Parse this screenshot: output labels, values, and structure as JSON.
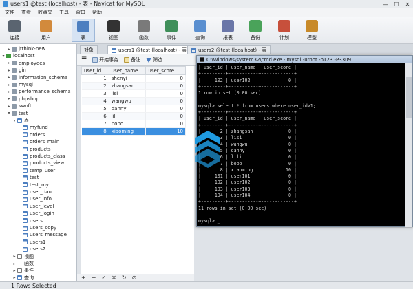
{
  "window": {
    "title": "users1 @test (localhost) - 表 - Navicat for MySQL",
    "controls": [
      "—",
      "☐",
      "✕"
    ]
  },
  "menu": [
    "文件",
    "查看",
    "收藏夹",
    "工具",
    "窗口",
    "帮助"
  ],
  "toolbar": [
    {
      "label": "连接",
      "icon": "plug-icon",
      "color": "#5a6470"
    },
    {
      "label": "用户",
      "icon": "user-icon",
      "color": "#d28a3c"
    },
    {
      "label": "表",
      "icon": "table-icon",
      "color": "#4d7fc0",
      "active": true
    },
    {
      "label": "视图",
      "icon": "glasses-icon",
      "color": "#333333"
    },
    {
      "label": "函数",
      "icon": "function-icon",
      "color": "#7a7a7a"
    },
    {
      "label": "事件",
      "icon": "event-icon",
      "color": "#3f8f5a"
    },
    {
      "label": "查询",
      "icon": "query-icon",
      "color": "#5a8fd0"
    },
    {
      "label": "报表",
      "icon": "report-icon",
      "color": "#6a76a8"
    },
    {
      "label": "备份",
      "icon": "backup-icon",
      "color": "#4aa35a"
    },
    {
      "label": "计划",
      "icon": "calendar-icon",
      "color": "#c7503c"
    },
    {
      "label": "模型",
      "icon": "model-icon",
      "color": "#c88a2a"
    }
  ],
  "sidebar": {
    "items": [
      {
        "label": "jtthink-new",
        "type": "db",
        "depth": 1
      },
      {
        "label": "localhost",
        "type": "conn",
        "depth": 0,
        "expanded": true
      },
      {
        "label": "employees",
        "type": "db",
        "depth": 1
      },
      {
        "label": "gin",
        "type": "db",
        "depth": 1
      },
      {
        "label": "information_schema",
        "type": "db",
        "depth": 1
      },
      {
        "label": "mysql",
        "type": "db",
        "depth": 1
      },
      {
        "label": "performance_schema",
        "type": "db",
        "depth": 1
      },
      {
        "label": "phpshop",
        "type": "db",
        "depth": 1
      },
      {
        "label": "swoft",
        "type": "db",
        "depth": 1
      },
      {
        "label": "test",
        "type": "db",
        "depth": 1,
        "expanded": true
      },
      {
        "label": "表",
        "type": "tbl",
        "depth": 2,
        "expanded": true
      },
      {
        "label": "myfund",
        "type": "tbl",
        "depth": 3
      },
      {
        "label": "orders",
        "type": "tbl",
        "depth": 3
      },
      {
        "label": "orders_main",
        "type": "tbl",
        "depth": 3
      },
      {
        "label": "products",
        "type": "tbl",
        "depth": 3
      },
      {
        "label": "products_class",
        "type": "tbl",
        "depth": 3
      },
      {
        "label": "products_view",
        "type": "tbl",
        "depth": 3
      },
      {
        "label": "temp_user",
        "type": "tbl",
        "depth": 3
      },
      {
        "label": "test",
        "type": "tbl",
        "depth": 3
      },
      {
        "label": "test_my",
        "type": "tbl",
        "depth": 3
      },
      {
        "label": "user_dau",
        "type": "tbl",
        "depth": 3
      },
      {
        "label": "user_info",
        "type": "tbl",
        "depth": 3
      },
      {
        "label": "user_level",
        "type": "tbl",
        "depth": 3
      },
      {
        "label": "user_login",
        "type": "tbl",
        "depth": 3
      },
      {
        "label": "users",
        "type": "tbl",
        "depth": 3
      },
      {
        "label": "users_copy",
        "type": "tbl",
        "depth": 3
      },
      {
        "label": "users_message",
        "type": "tbl",
        "depth": 3
      },
      {
        "label": "users1",
        "type": "tbl",
        "depth": 3
      },
      {
        "label": "users2",
        "type": "tbl",
        "depth": 3
      },
      {
        "label": "视图",
        "type": "view",
        "depth": 2
      },
      {
        "label": "函数",
        "type": "fn",
        "depth": 2
      },
      {
        "label": "事件",
        "type": "evt",
        "depth": 2
      },
      {
        "label": "查询",
        "type": "query",
        "depth": 2
      }
    ]
  },
  "tabs": [
    {
      "label": "对象"
    },
    {
      "label": "users1 @test (localhost) - 表",
      "active": true
    },
    {
      "label": "users2 @test (localhost) - 表"
    }
  ],
  "subtoolbar": {
    "menu_glyph": "☰",
    "begin_tx": "开始事务",
    "note": "备注",
    "filter": "筛选"
  },
  "grid": {
    "columns": [
      "user_id",
      "user_name",
      "user_score"
    ],
    "rows": [
      [
        "1",
        "shenyi",
        "0"
      ],
      [
        "2",
        "zhangsan",
        "0"
      ],
      [
        "3",
        "lisi",
        "0"
      ],
      [
        "4",
        "wangwu",
        "0"
      ],
      [
        "5",
        "danny",
        "0"
      ],
      [
        "6",
        "lili",
        "0"
      ],
      [
        "7",
        "bobo",
        "0"
      ],
      [
        "8",
        "xiaoming",
        "10"
      ]
    ],
    "selected_index": 7
  },
  "bottom_tools": [
    "+",
    "−",
    "✓",
    "✕",
    "↻",
    "⊘"
  ],
  "status": "1 Rows Selected",
  "cmd": {
    "title": "C:\\Windows\\system32\\cmd.exe - mysql  -uroot -p123 -P3309",
    "lines": [
      "| user_id | user_name | user_score |",
      "+---------+-----------+------------+",
      "|     102 | user102   |          0 |",
      "+---------+-----------+------------+",
      "1 row in set (0.00 sec)",
      "",
      "mysql> select * from users where user_id>1;",
      "+---------+-----------+------------+",
      "| user_id | user_name | user_score |",
      "+---------+-----------+------------+",
      "|       2 | zhangsan  |          0 |",
      "|       3 | lisi      |          0 |",
      "|       4 | wangwu    |          0 |",
      "|       5 | danny     |          0 |",
      "|       6 | lili      |          0 |",
      "|       7 | bobo      |          0 |",
      "|       8 | xiaoming  |         10 |",
      "|     101 | user101   |          0 |",
      "|     102 | user102   |          0 |",
      "|     103 | user103   |          0 |",
      "|     104 | user104   |          0 |",
      "+---------+-----------+------------+",
      "11 rows in set (0.00 sec)",
      "",
      "mysql> _"
    ]
  },
  "colors": {
    "selection": "#3b8fe0",
    "console_bg": "#000000",
    "console_fg": "#d9d9d9",
    "logo_blue": "#1f9ae0"
  }
}
